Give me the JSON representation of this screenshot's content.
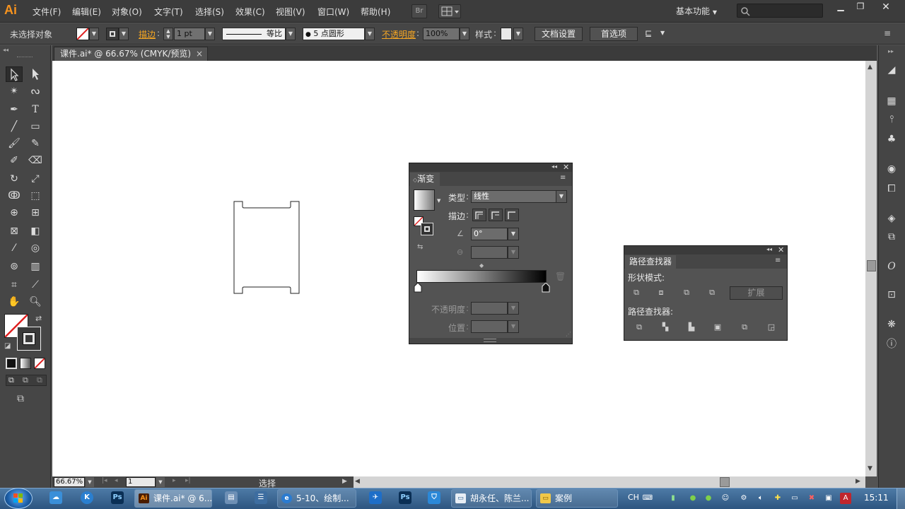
{
  "app": {
    "logo": "Ai"
  },
  "menu": {
    "items": [
      "文件(F)",
      "编辑(E)",
      "对象(O)",
      "文字(T)",
      "选择(S)",
      "效果(C)",
      "视图(V)",
      "窗口(W)",
      "帮助(H)"
    ],
    "bridge_label": "Br",
    "workspace": "基本功能",
    "search_placeholder": ""
  },
  "control_bar": {
    "selection_status": "未选择对象",
    "stroke_label": "描边",
    "stroke_weight": "1 pt",
    "stroke_profile": "等比",
    "brush": "5 点圆形",
    "opacity_label": "不透明度",
    "opacity_value": "100%",
    "style_label": "样式",
    "doc_setup_button": "文档设置",
    "preferences_button": "首选项"
  },
  "document": {
    "tab_title": "课件.ai* @ 66.67% (CMYK/预览)",
    "close_symbol": "×"
  },
  "status_bar": {
    "zoom": "66.67%",
    "artboard_number": "1",
    "tool_status": "选择"
  },
  "gradient_panel": {
    "title": "渐变",
    "type_label": "类型",
    "type_value": "线性",
    "stroke_label": "描边",
    "angle_value": "0°",
    "opacity_label": "不透明度",
    "location_label": "位置",
    "gradient_start": "#ffffff",
    "gradient_end": "#000000"
  },
  "pathfinder_panel": {
    "title": "路径查找器",
    "shape_modes_label": "形状模式:",
    "expand_button": "扩展",
    "pathfinders_label": "路径查找器:"
  },
  "taskbar": {
    "items": [
      {
        "label": "课件.ai* @ 6...",
        "icon": "Ai",
        "active": true
      },
      {
        "label": "5-10、绘制...",
        "icon": "ie",
        "active": false
      },
      {
        "label": "胡永任、陈兰...",
        "icon": "chat",
        "active": false
      },
      {
        "label": "案例",
        "icon": "folder",
        "active": false
      }
    ],
    "ime": "CH",
    "clock": "15:11"
  },
  "colors": {
    "accent_orange": "#f5a623",
    "ui_dark": "#535353",
    "artboard": "#ffffff"
  }
}
